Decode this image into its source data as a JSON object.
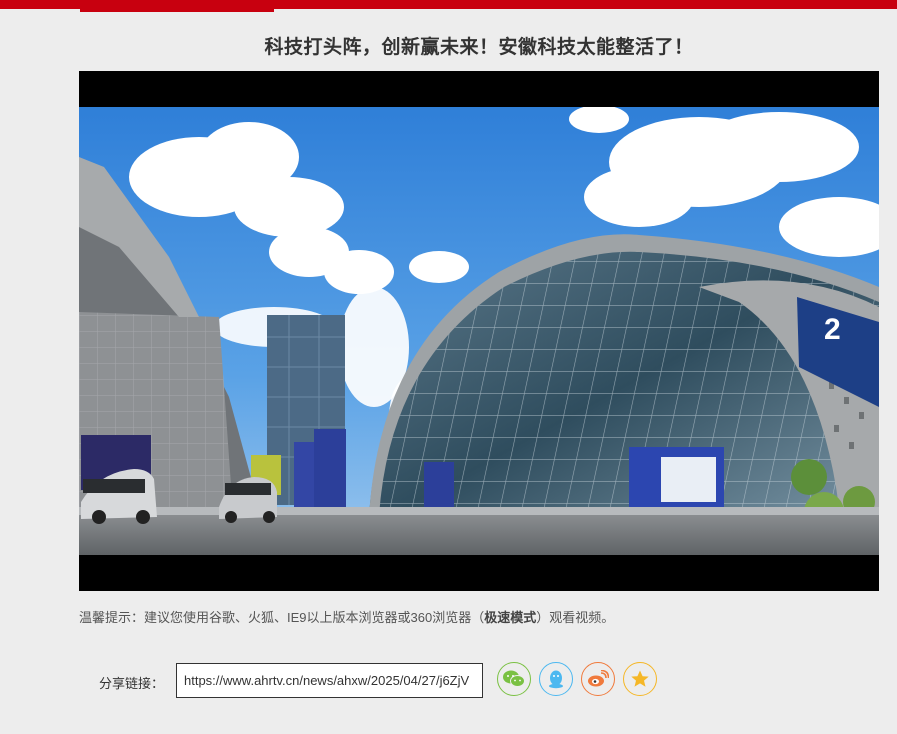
{
  "article": {
    "title": "科技打头阵，创新赢未来！安徽科技太能整活了！"
  },
  "video": {
    "building_sign": "2"
  },
  "tip": {
    "prefix": "温馨提示：建议您使用谷歌、火狐、IE9以上版本浏览器或360浏览器（",
    "bold": "极速模式",
    "suffix": "）观看视频。"
  },
  "share": {
    "label": "分享链接：",
    "url": "https://www.ahrtv.cn/news/ahxw/2025/04/27/j6ZjV",
    "buttons": [
      {
        "name": "wechat",
        "icon": "wechat-icon",
        "color": "#7ac143"
      },
      {
        "name": "qq",
        "icon": "qq-icon",
        "color": "#4cb8f0"
      },
      {
        "name": "weibo",
        "icon": "weibo-icon",
        "color": "#f07a3c"
      },
      {
        "name": "favorite",
        "icon": "star-icon",
        "color": "#f5b727"
      }
    ]
  },
  "colors": {
    "brand_red": "#c8000f",
    "page_bg": "#ededed"
  }
}
